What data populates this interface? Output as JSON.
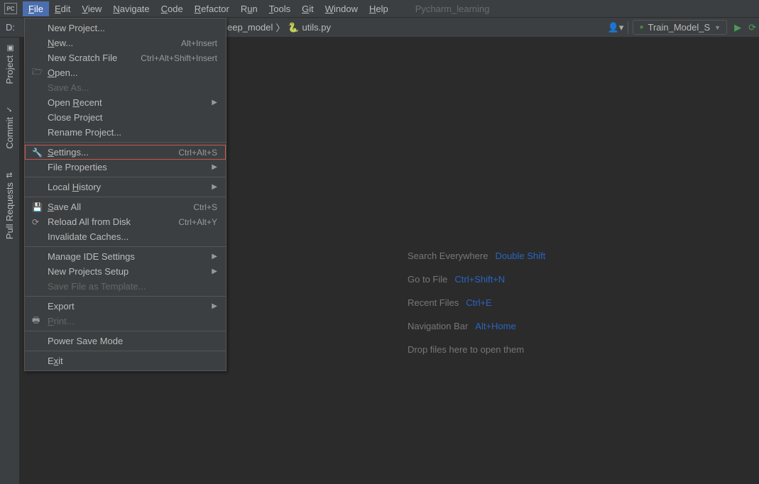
{
  "app_icon": "PC",
  "menubar": {
    "items": [
      {
        "label": "File",
        "mn": "F",
        "active": true
      },
      {
        "label": "Edit",
        "mn": "E"
      },
      {
        "label": "View",
        "mn": "V"
      },
      {
        "label": "Navigate",
        "mn": "N"
      },
      {
        "label": "Code",
        "mn": "C"
      },
      {
        "label": "Refactor",
        "mn": "R"
      },
      {
        "label": "Run",
        "mn": "u"
      },
      {
        "label": "Tools",
        "mn": "T"
      },
      {
        "label": "Git",
        "mn": "G"
      },
      {
        "label": "Window",
        "mn": "W"
      },
      {
        "label": "Help",
        "mn": "H"
      }
    ],
    "project": "Pycharm_learning"
  },
  "navbar": {
    "drive": "D:",
    "crumb_partial": "eep_model",
    "file": "utils.py",
    "run_config": "Train_Model_S"
  },
  "toolstrip": {
    "project": "Project",
    "commit": "Commit",
    "pull": "Pull Requests"
  },
  "hints": [
    {
      "label": "Search Everywhere",
      "shortcut": "Double Shift"
    },
    {
      "label": "Go to File",
      "shortcut": "Ctrl+Shift+N"
    },
    {
      "label": "Recent Files",
      "shortcut": "Ctrl+E"
    },
    {
      "label": "Navigation Bar",
      "shortcut": "Alt+Home"
    },
    {
      "label": "Drop files here to open them",
      "shortcut": ""
    }
  ],
  "file_menu": [
    {
      "label": "New Project...",
      "type": "item"
    },
    {
      "label": "New...",
      "mn": "N",
      "shortcut": "Alt+Insert",
      "type": "item"
    },
    {
      "label": "New Scratch File",
      "shortcut": "Ctrl+Alt+Shift+Insert",
      "type": "item"
    },
    {
      "label": "Open...",
      "mn": "O",
      "icon": "folder",
      "type": "item"
    },
    {
      "label": "Save As...",
      "disabled": true,
      "type": "item"
    },
    {
      "label": "Open Recent",
      "mn": "R",
      "submenu": true,
      "type": "item"
    },
    {
      "label": "Close Project",
      "mn": "j",
      "type": "item"
    },
    {
      "label": "Rename Project...",
      "type": "item"
    },
    {
      "type": "sep"
    },
    {
      "label": "Settings...",
      "mn": "S",
      "shortcut": "Ctrl+Alt+S",
      "icon": "wrench",
      "highlighted": true,
      "type": "item"
    },
    {
      "label": "File Properties",
      "submenu": true,
      "type": "item"
    },
    {
      "type": "sep"
    },
    {
      "label": "Local History",
      "mn": "H",
      "submenu": true,
      "type": "item"
    },
    {
      "type": "sep"
    },
    {
      "label": "Save All",
      "mn": "S",
      "shortcut": "Ctrl+S",
      "icon": "save",
      "type": "item"
    },
    {
      "label": "Reload All from Disk",
      "shortcut": "Ctrl+Alt+Y",
      "icon": "reload",
      "type": "item"
    },
    {
      "label": "Invalidate Caches...",
      "type": "item"
    },
    {
      "type": "sep"
    },
    {
      "label": "Manage IDE Settings",
      "submenu": true,
      "type": "item"
    },
    {
      "label": "New Projects Setup",
      "submenu": true,
      "type": "item"
    },
    {
      "label": "Save File as Template...",
      "disabled": true,
      "type": "item"
    },
    {
      "type": "sep"
    },
    {
      "label": "Export",
      "submenu": true,
      "type": "item"
    },
    {
      "label": "Print...",
      "mn": "P",
      "icon": "print",
      "disabled": true,
      "type": "item"
    },
    {
      "type": "sep"
    },
    {
      "label": "Power Save Mode",
      "type": "item"
    },
    {
      "type": "sep"
    },
    {
      "label": "Exit",
      "mn": "x",
      "type": "item"
    }
  ]
}
